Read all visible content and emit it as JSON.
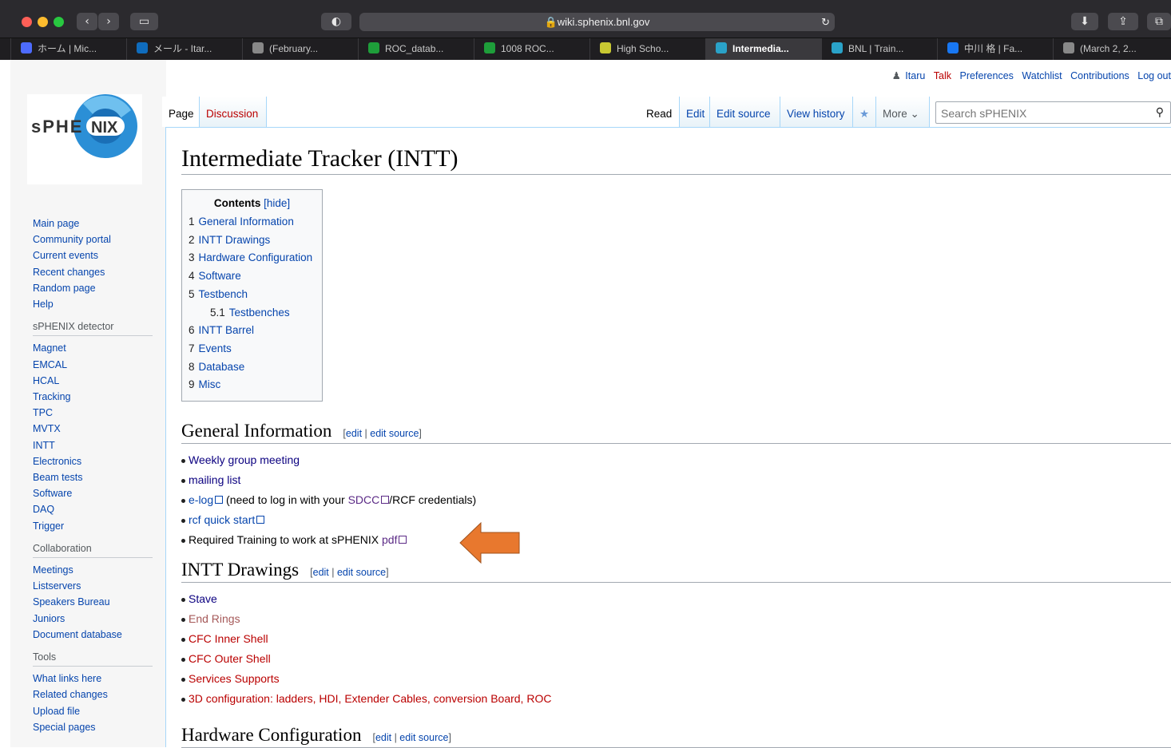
{
  "browser": {
    "url": "wiki.sphenix.bnl.gov",
    "tabs": [
      {
        "label": "ホーム | Mic...",
        "color": "#4d6bfe"
      },
      {
        "label": "メール - Itar...",
        "color": "#0f6cbd"
      },
      {
        "label": "(February...",
        "color": "#888888"
      },
      {
        "label": "ROC_datab...",
        "color": "#1e9e3a"
      },
      {
        "label": "1008 ROC...",
        "color": "#1e9e3a"
      },
      {
        "label": "High Scho...",
        "color": "#c8c832"
      },
      {
        "label": "Intermedia...",
        "color": "#2aa2c8"
      },
      {
        "label": "BNL | Train...",
        "color": "#2aa2c8"
      },
      {
        "label": "中川 格 | Fa...",
        "color": "#1877f2"
      },
      {
        "label": "(March 2, 2...",
        "color": "#888888"
      }
    ]
  },
  "personal": {
    "user": "Itaru",
    "talk": "Talk",
    "preferences": "Preferences",
    "watchlist": "Watchlist",
    "contributions": "Contributions",
    "logout": "Log out"
  },
  "logo": {
    "text_left": "sPHE",
    "text_circle": "NIX"
  },
  "nav": {
    "main": [
      "Main page",
      "Community portal",
      "Current events",
      "Recent changes",
      "Random page",
      "Help"
    ],
    "detector_heading": "sPHENIX detector",
    "detector": [
      "Magnet",
      "EMCAL",
      "HCAL",
      "Tracking",
      "TPC",
      "MVTX",
      "INTT",
      "Electronics",
      "Beam tests",
      "Software",
      "DAQ",
      "Trigger"
    ],
    "collab_heading": "Collaboration",
    "collab": [
      "Meetings",
      "Listservers",
      "Speakers Bureau",
      "Juniors",
      "Document database"
    ],
    "tools_heading": "Tools",
    "tools": [
      "What links here",
      "Related changes",
      "Upload file",
      "Special pages"
    ]
  },
  "page_tabs": {
    "page": "Page",
    "discussion": "Discussion",
    "read": "Read",
    "edit": "Edit",
    "edit_source": "Edit source",
    "view_history": "View history",
    "more": "More",
    "search_placeholder": "Search sPHENIX"
  },
  "title": "Intermediate Tracker (INTT)",
  "toc": {
    "heading": "Contents",
    "hide": "[hide]",
    "items": [
      {
        "num": "1",
        "label": "General Information"
      },
      {
        "num": "2",
        "label": "INTT Drawings"
      },
      {
        "num": "3",
        "label": "Hardware Configuration"
      },
      {
        "num": "4",
        "label": "Software"
      },
      {
        "num": "5",
        "label": "Testbench"
      },
      {
        "num": "5.1",
        "label": "Testbenches"
      },
      {
        "num": "6",
        "label": "INTT Barrel"
      },
      {
        "num": "7",
        "label": "Events"
      },
      {
        "num": "8",
        "label": "Database"
      },
      {
        "num": "9",
        "label": "Misc"
      }
    ]
  },
  "edit_links": {
    "open": "[",
    "edit": "edit",
    "sep": " | ",
    "edit_source": "edit source",
    "close": "]"
  },
  "sections": {
    "general": {
      "heading": "General Information",
      "weekly": "Weekly group meeting",
      "mailing": "mailing list",
      "elog": "e-log",
      "elog_text1": " (need to log in with your ",
      "sdcc": "SDCC",
      "elog_text2": "/RCF credentials)",
      "rcf": "rcf quick start",
      "training_text": "Required Training to work at sPHENIX ",
      "pdf": "pdf"
    },
    "drawings": {
      "heading": "INTT Drawings",
      "items": [
        "Stave",
        "End Rings",
        "CFC Inner Shell",
        "CFC Outer Shell",
        "Services Supports",
        "3D configuration: ladders, HDI, Extender Cables, conversion Board, ROC"
      ]
    },
    "hardware": {
      "heading": "Hardware Configuration"
    }
  },
  "colors": {
    "arrow": "#e8782e",
    "link": "#0645ad",
    "redlink": "#ba0000"
  }
}
